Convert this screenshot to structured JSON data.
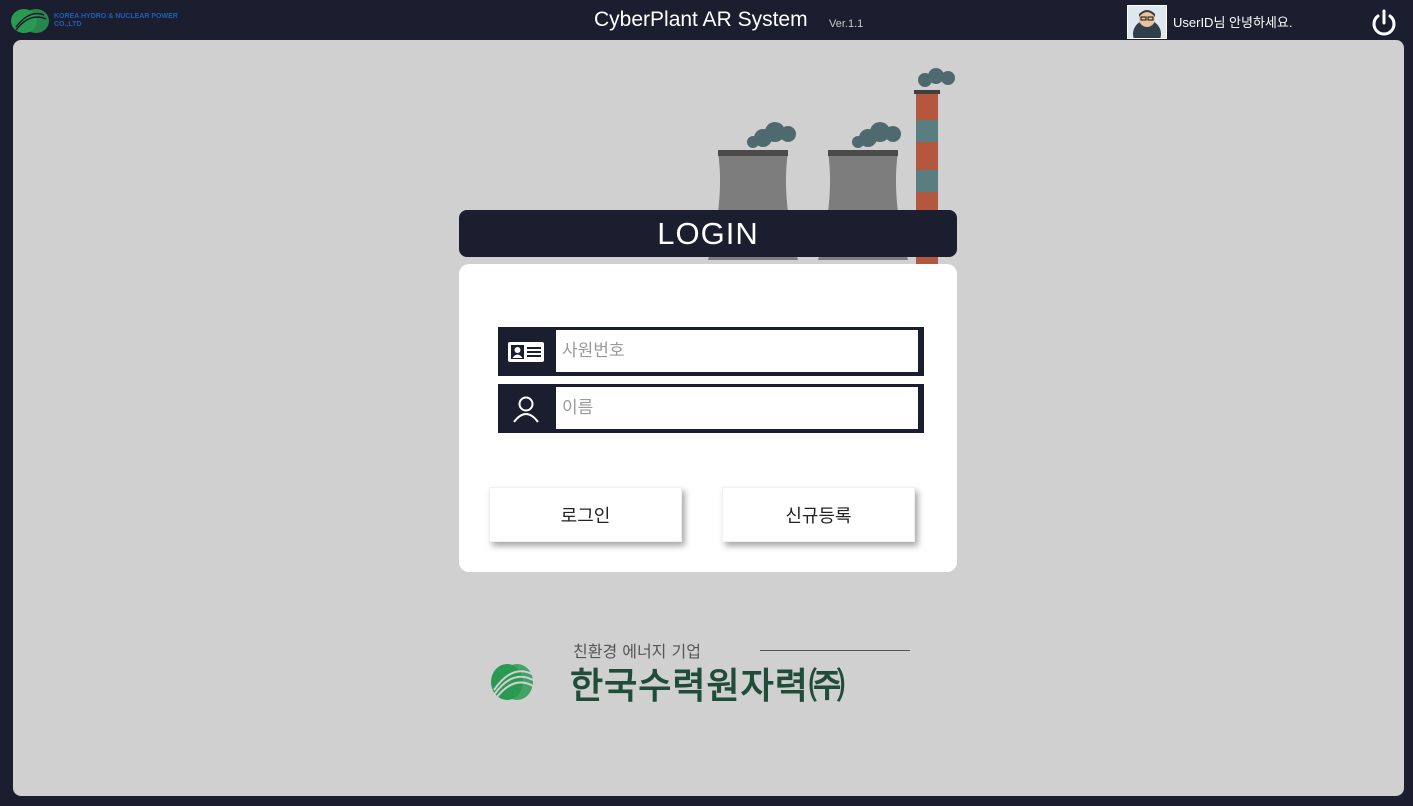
{
  "header": {
    "brand_text": "KOREA HYDRO & NUCLEAR POWER CO.,LTD",
    "title": "CyberPlant AR System",
    "version": "Ver.1.1",
    "greeting": "UserID님 안녕하세요.",
    "avatar_icon": "user-avatar-icon",
    "power_icon": "power-icon"
  },
  "login": {
    "heading": "LOGIN",
    "employee_id_placeholder": "사원번호",
    "employee_id_value": "",
    "name_placeholder": "이름",
    "name_value": "",
    "employee_id_icon": "id-card-icon",
    "name_icon": "user-icon",
    "login_button": "로그인",
    "register_button": "신규등록"
  },
  "footer": {
    "slogan": "친환경 에너지 기업",
    "company_name": "한국수력원자력㈜"
  },
  "colors": {
    "dark": "#1b1e2e",
    "panel": "#d0d0d0",
    "brand_green": "#1f4d3a",
    "brand_blue": "#1f5fb7"
  }
}
